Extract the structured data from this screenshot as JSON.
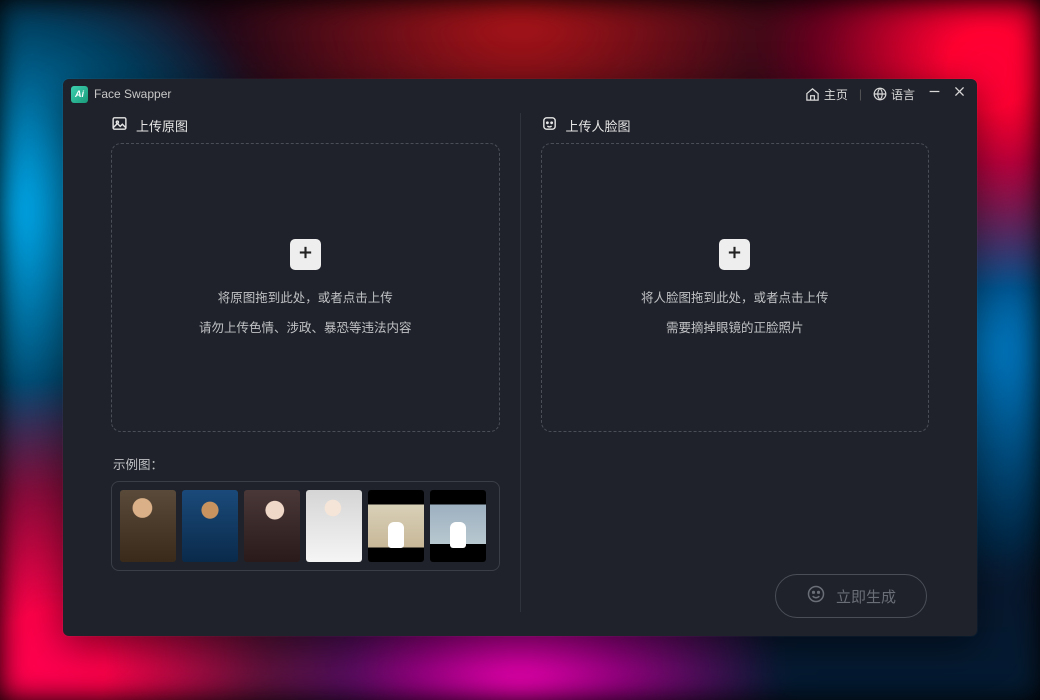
{
  "app": {
    "logo_text": "Ai",
    "name": "Face Swapper"
  },
  "titlebar": {
    "home": "主页",
    "language": "语言"
  },
  "left_panel": {
    "title": "上传原图",
    "line1": "将原图拖到此处，或者点击上传",
    "line2": "请勿上传色情、涉政、暴恐等违法内容",
    "samples_label": "示例图："
  },
  "right_panel": {
    "title": "上传人脸图",
    "line1": "将人脸图拖到此处，或者点击上传",
    "line2": "需要摘掉眼镜的正脸照片"
  },
  "generate_label": "立即生成"
}
